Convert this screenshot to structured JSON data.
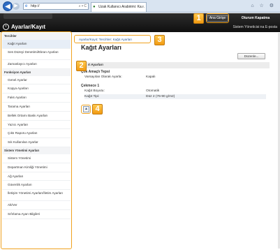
{
  "browser": {
    "address": "http://",
    "address_controls": "⌕ ▾ C",
    "tab_title": "Uzak Kullanıcı Arabirimi: Ka...",
    "tab_close": "×",
    "icons": "⌂ ☆ ⚙"
  },
  "header": {
    "portal_title": "Ayarlar/Kayıt",
    "home_button": "Ana Girişe",
    "logout_button": "Oturum Kapatma",
    "user_label": "Sistem Yöneticisi:na E-posta"
  },
  "sidebar": {
    "sections": [
      {
        "title": "Tercihler",
        "items": [
          {
            "label": "Kağıt Ayarları"
          },
          {
            "label": "Ses Düzeyi Denetimi/Ekran Ayarları"
          },
          {
            "label": "Zamanlayıcı Ayarları"
          }
        ]
      },
      {
        "title": "Fonksiyon Ayarları",
        "items": [
          {
            "label": "Genel Ayarlar"
          },
          {
            "label": "Kopya Ayarları"
          },
          {
            "label": "Faks Ayarları"
          },
          {
            "label": "Tarama Ayarları"
          },
          {
            "label": "Bellek Ortamı Baskı Ayarları"
          },
          {
            "label": "Yazıcı Ayarları"
          },
          {
            "label": "Çıktı Raporu Ayarları"
          },
          {
            "label": "Sık Kullanılan Ayarlar"
          }
        ]
      },
      {
        "title": "Sistem Yönetimi Ayarları",
        "items": [
          {
            "label": "Sistem Yönetimi"
          },
          {
            "label": "Departman Kimliği Yönetimi"
          },
          {
            "label": "Ağ Ayarları"
          },
          {
            "label": "Güvenlik Ayarları"
          },
          {
            "label": "İletişim Yönetimi Ayarları/İletim Ayarları"
          },
          {
            "label": "Alt/Ver"
          },
          {
            "label": "Sıfırlama Ayarı Bilgileri"
          }
        ]
      }
    ]
  },
  "main": {
    "breadcrumb": "Ayarlar/Kayıt: Tercihler: Kağıt Ayarları",
    "page_title": "Kağıt Ayarları",
    "edit_button": "Düzenle...",
    "settings_header": "ıt Ayarları",
    "multipurpose_label": "Çok Amaçlı Tepsi",
    "multipurpose_rows": [
      {
        "key": "Varsayılan Olarak Ayarla:",
        "value": "Kapalı"
      }
    ],
    "drawer_label": "Çekmece 1",
    "drawer_rows": [
      {
        "key": "Kağıt Boyutu:",
        "value": "Otomatik"
      },
      {
        "key": "Kağıt Tipi:",
        "value": "Düz 2 (76-90 g/m2)"
      }
    ],
    "top_button": "▲"
  },
  "callouts": [
    "1",
    "2",
    "3",
    "4"
  ],
  "colors": {
    "callout": "#f0a21e",
    "header_bg": "#1a1a1a",
    "link": "#2d5d9a"
  }
}
